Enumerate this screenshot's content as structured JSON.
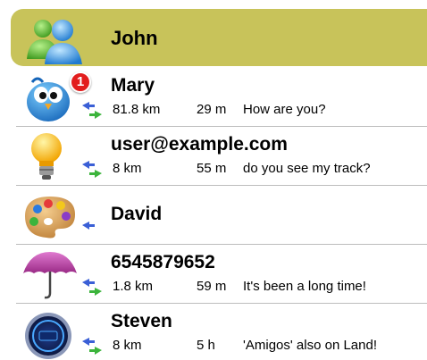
{
  "header": {
    "title": "John",
    "icon": "contacts-group-icon",
    "color": "#c8c35a"
  },
  "contacts": [
    {
      "name": "Mary",
      "badge": "1",
      "distance": "81.8 km",
      "age": "29 m",
      "message": "How are you?",
      "avatar": "bird-icon"
    },
    {
      "name": "user@example.com",
      "distance": "8 km",
      "age": "55 m",
      "message": "do you see my track?",
      "avatar": "lightbulb-icon"
    },
    {
      "name": "David",
      "distance": "",
      "age": "",
      "message": "",
      "avatar": "paint-palette-icon"
    },
    {
      "name": "6545879652",
      "distance": "1.8 km",
      "age": "59 m",
      "message": "It's been a long time!",
      "avatar": "umbrella-icon"
    },
    {
      "name": "Steven",
      "distance": "8 km",
      "age": "5 h",
      "message": "'Amigos' also on Land!",
      "avatar": "speedometer-icon"
    }
  ],
  "icons": {
    "sync": "sync-arrows-icon"
  },
  "colors": {
    "badge": "#e21d1d",
    "arrow_blue": "#3a5fd6",
    "arrow_green": "#3cb43c"
  }
}
